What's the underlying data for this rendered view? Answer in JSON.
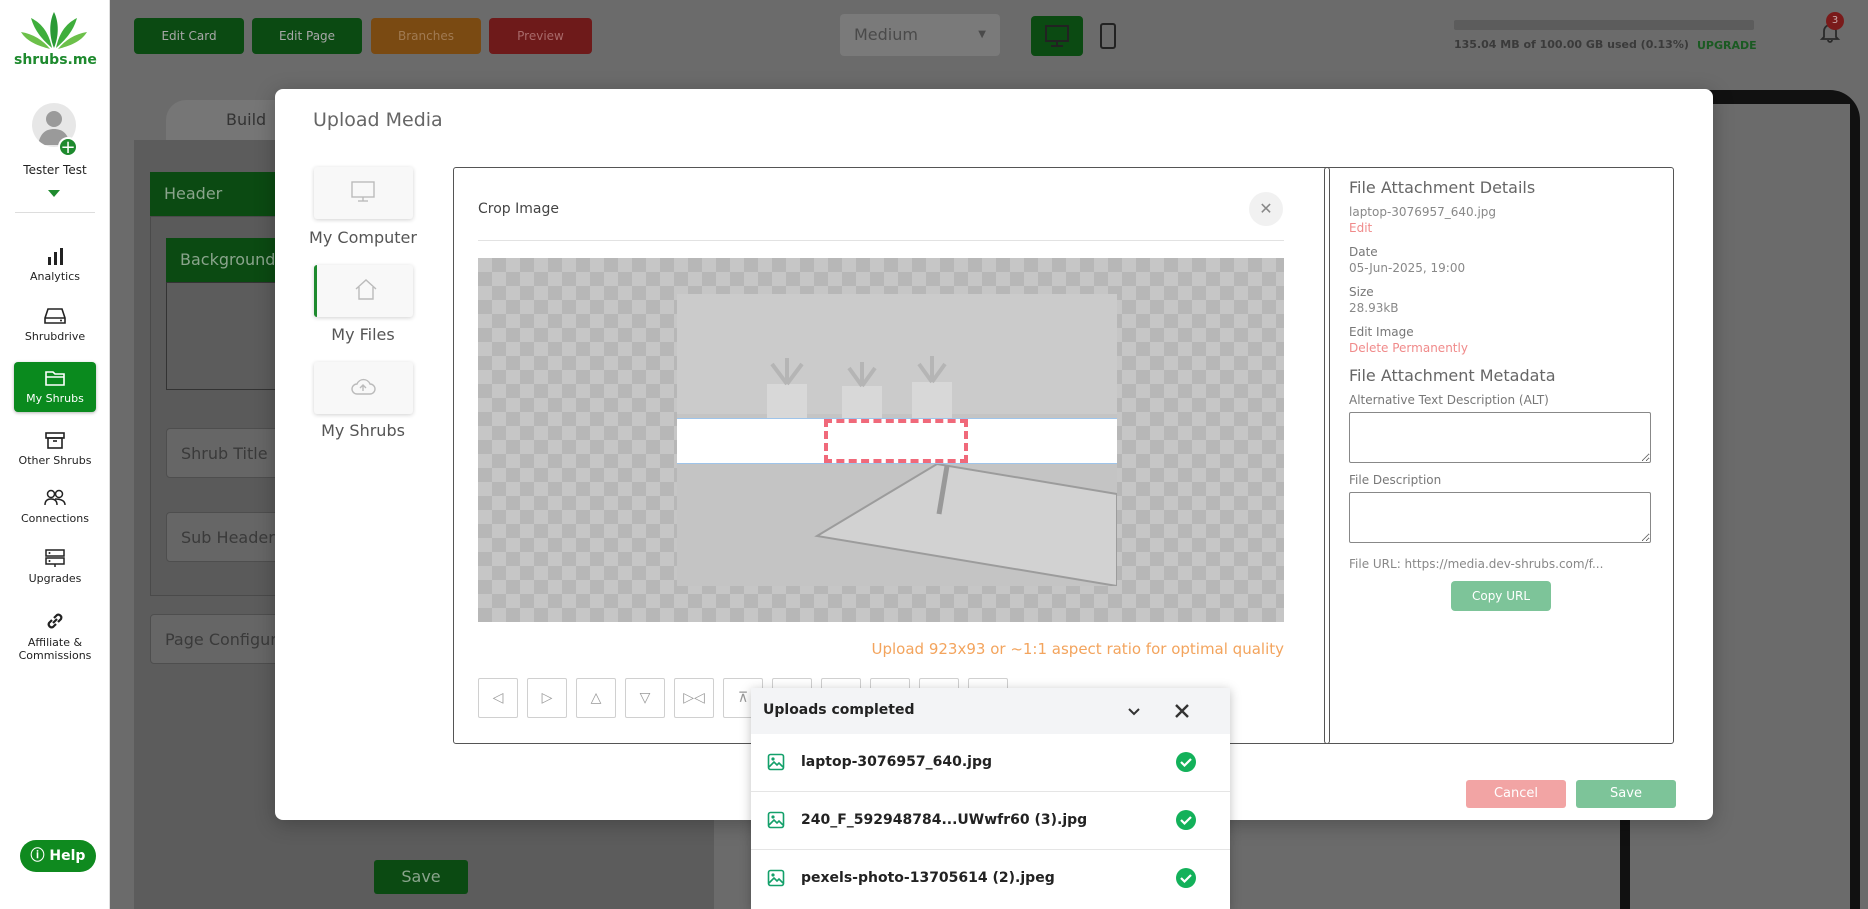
{
  "app": {
    "logo_text": "shrubs.me"
  },
  "user": {
    "name": "Tester Test"
  },
  "sidebar": {
    "items": [
      {
        "label": "Analytics",
        "icon": "bar-chart-icon"
      },
      {
        "label": "Shrubdrive",
        "icon": "drive-icon"
      },
      {
        "label": "My Shrubs",
        "icon": "folder-icon",
        "active": true
      },
      {
        "label": "Other Shrubs",
        "icon": "archive-icon"
      },
      {
        "label": "Connections",
        "icon": "users-icon"
      },
      {
        "label": "Upgrades",
        "icon": "server-icon"
      },
      {
        "label": "Affiliate & Commissions",
        "icon": "link-icon"
      }
    ],
    "help_label": "Help"
  },
  "toolbar": {
    "edit_card": "Edit Card",
    "edit_page": "Edit Page",
    "branches": "Branches",
    "preview": "Preview",
    "size_select": "Medium",
    "storage_text": "135.04 MB of 100.00 GB used (0.13%)",
    "upgrade": "UPGRADE",
    "notification_count": "3"
  },
  "background": {
    "build_tab": "Build",
    "header": "Header",
    "background": "Background",
    "shrub_title": "Shrub Title",
    "sub_header": "Sub Header",
    "page_config": "Page Configura",
    "save": "Save"
  },
  "modal": {
    "title": "Upload Media",
    "sources": [
      {
        "label": "My Computer",
        "icon": "monitor-icon"
      },
      {
        "label": "My Files",
        "icon": "home-icon",
        "active": true
      },
      {
        "label": "My Shrubs",
        "icon": "cloud-upload-icon"
      }
    ],
    "crop": {
      "title": "Crop Image",
      "hint": "Upload 923x93 or ~1:1 aspect ratio for optimal quality"
    },
    "details": {
      "heading": "File Attachment Details",
      "filename": "laptop-3076957_640.jpg",
      "edit": "Edit",
      "date_label": "Date",
      "date_value": "05-Jun-2025, 19:00",
      "size_label": "Size",
      "size_value": "28.93kB",
      "edit_image": "Edit Image",
      "delete": "Delete Permanently",
      "meta_heading": "File Attachment Metadata",
      "alt_label": "Alternative Text Description (ALT)",
      "desc_label": "File Description",
      "file_url": "File URL: https://media.dev-shrubs.com/f...",
      "copy_url": "Copy URL"
    },
    "cancel": "Cancel",
    "save": "Save"
  },
  "uploads": {
    "title": "Uploads completed",
    "files": [
      "laptop-3076957_640.jpg",
      "240_F_592948784...UWwfr60 (3).jpg",
      "pexels-photo-13705614 (2).jpeg"
    ]
  },
  "colors": {
    "brand_green": "#1e8a2e",
    "success_green": "#13b15a",
    "hint_orange": "#f3a45d",
    "danger_red": "#f08a8a"
  }
}
